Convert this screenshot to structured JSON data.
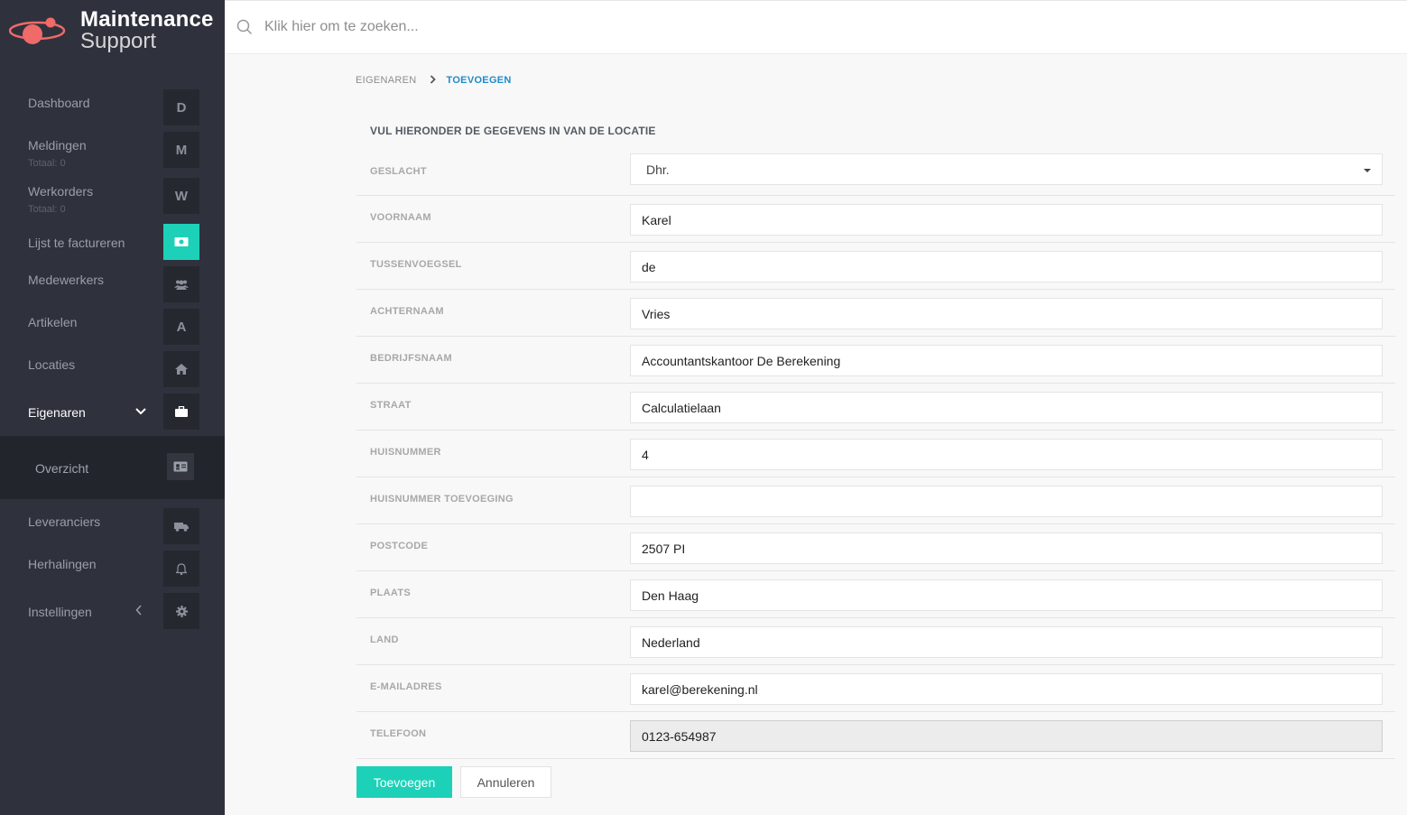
{
  "brand": {
    "title": "Maintenance",
    "subtitle": "Support",
    "accent": "#1dd1b8",
    "logo_color": "#f06a6a"
  },
  "search": {
    "placeholder": "Klik hier om te zoeken..."
  },
  "sidebar": {
    "items": [
      {
        "label": "Dashboard",
        "badge": "D"
      },
      {
        "label": "Meldingen",
        "sub": "Totaal: 0",
        "badge": "M"
      },
      {
        "label": "Werkorders",
        "sub": "Totaal: 0",
        "badge": "W"
      },
      {
        "label": "Lijst te factureren",
        "icon": "money-icon"
      },
      {
        "label": "Medewerkers",
        "icon": "users-icon"
      },
      {
        "label": "Artikelen",
        "badge": "A"
      },
      {
        "label": "Locaties",
        "icon": "home-icon"
      },
      {
        "label": "Eigenaren",
        "icon": "briefcase-icon"
      },
      {
        "label": "Leveranciers",
        "icon": "truck-icon"
      },
      {
        "label": "Herhalingen",
        "icon": "bell-icon"
      },
      {
        "label": "Instellingen",
        "icon": "gear-icon"
      }
    ],
    "submenu": {
      "label": "Overzicht",
      "icon": "id-card-icon"
    }
  },
  "breadcrumb": {
    "parent": "EIGENAREN",
    "current": "TOEVOEGEN"
  },
  "form": {
    "title": "VUL HIERONDER DE GEGEVENS IN VAN DE LOCATIE",
    "fields": [
      {
        "label": "GESLACHT",
        "value": "Dhr."
      },
      {
        "label": "VOORNAAM",
        "value": "Karel"
      },
      {
        "label": "TUSSENVOEGSEL",
        "value": "de"
      },
      {
        "label": "ACHTERNAAM",
        "value": "Vries"
      },
      {
        "label": "BEDRIJFSNAAM",
        "value": "Accountantskantoor De Berekening"
      },
      {
        "label": "STRAAT",
        "value": "Calculatielaan"
      },
      {
        "label": "HUISNUMMER",
        "value": "4"
      },
      {
        "label": "HUISNUMMER TOEVOEGING",
        "value": ""
      },
      {
        "label": "POSTCODE",
        "value": "2507 PI"
      },
      {
        "label": "PLAATS",
        "value": "Den Haag"
      },
      {
        "label": "LAND",
        "value": "Nederland"
      },
      {
        "label": "E-MAILADRES",
        "value": "karel@berekening.nl"
      },
      {
        "label": "TELEFOON",
        "value": "0123-654987"
      }
    ],
    "submit_label": "Toevoegen",
    "cancel_label": "Annuleren"
  }
}
